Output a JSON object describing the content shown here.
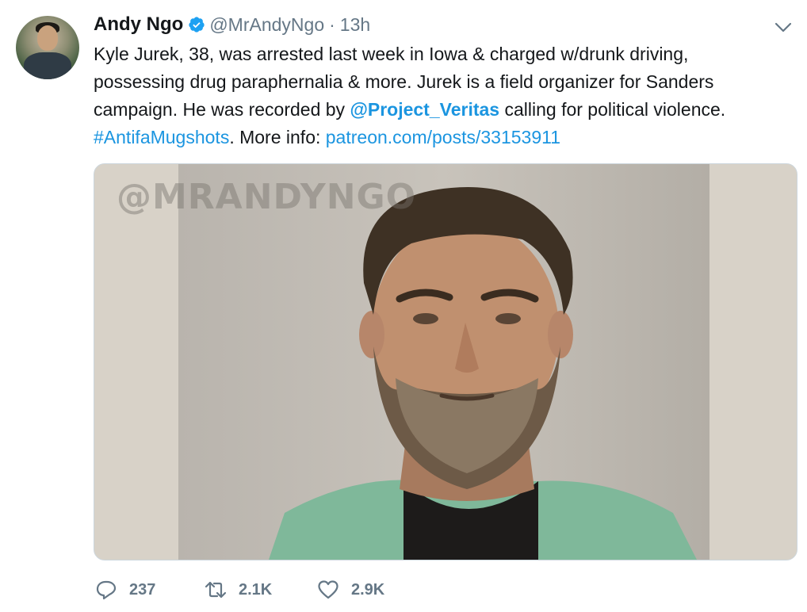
{
  "author": {
    "display_name": "Andy Ngo",
    "handle": "@MrAndyNgo",
    "separator": "·",
    "time": "13h",
    "verified": true
  },
  "tweet": {
    "line1": "Kyle Jurek, 38, was arrested last week in Iowa & charged w/drunk driving,",
    "line2": "possessing drug paraphernalia & more. Jurek is a field organizer for Sanders",
    "line3_start": "campaign. He was recorded by ",
    "mention": "@Project_Veritas",
    "line3_end": " calling for political violence.",
    "hashtag": "#AntifaMugshots",
    "more_info": ". More info: ",
    "link": "patreon.com/posts/33153911"
  },
  "media": {
    "watermark": "@MRANDYNGO"
  },
  "actions": {
    "replies": "237",
    "retweets": "2.1K",
    "likes": "2.9K"
  },
  "icons": {
    "verified": "verified-badge-icon",
    "caret": "chevron-down-icon",
    "reply": "reply-icon",
    "retweet": "retweet-icon",
    "like": "heart-icon"
  },
  "colors": {
    "link": "#1b95e0",
    "muted": "#657786",
    "text": "#14171a",
    "verified": "#1da1f2",
    "border": "#ccd6dd"
  }
}
